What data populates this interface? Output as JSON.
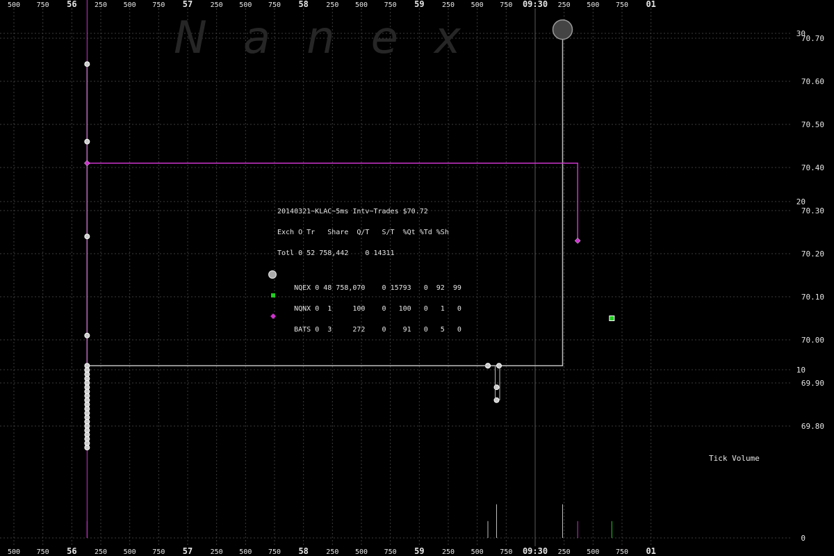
{
  "watermark": "Nanex",
  "time_axis": {
    "top_labels": [
      "500",
      "750",
      "56",
      "250",
      "500",
      "750",
      "57",
      "250",
      "500",
      "750",
      "58",
      "250",
      "500",
      "750",
      "59",
      "250",
      "500",
      "750",
      "09:30",
      "250",
      "500",
      "750",
      "01"
    ],
    "bottom_labels": [
      "500",
      "750",
      "56",
      "250",
      "500",
      "750",
      "57",
      "250",
      "500",
      "750",
      "58",
      "250",
      "500",
      "750",
      "59",
      "250",
      "500",
      "750",
      "09:30",
      "250",
      "500",
      "750",
      "01"
    ],
    "bold_labels": [
      "56",
      "57",
      "58",
      "59",
      "09:30",
      "01"
    ]
  },
  "stats_box": {
    "title": "20140321~KLAC~5ms Intv~Trades $70.72",
    "rows": [
      {
        "text": "Exch O Tr   Share  Q/T   S/T  %Qt %Td %Sh",
        "marker": ""
      },
      {
        "text": "Totl 0 52 758,442    0 14311",
        "marker": ""
      },
      {
        "text": "NQEX 0 48 758,070    0 15793   0  92  99",
        "marker": "gray-circle"
      },
      {
        "text": "NQNX 0  1     100    0   100   0   1   0",
        "marker": "green-square"
      },
      {
        "text": "BATS 0  3     272    0    91   0   5   0",
        "marker": "magenta-diamond"
      }
    ]
  },
  "volume_label": "Tick Volume",
  "colors": {
    "background": "#000000",
    "grid": "#3c3c3c",
    "nqex": "#bfbfbf",
    "nqnx": "#22cc22",
    "bats": "#cc33cc",
    "text": "#e6e6e6"
  },
  "chart_data": {
    "type": "line",
    "title": "20140321~KLAC~5ms Intv~Trades $70.72",
    "x_unit": "milliseconds after 09:29:55.500",
    "xlim": [
      0,
      6000
    ],
    "price_axis": {
      "ylim": [
        69.74,
        70.78
      ],
      "ticks": [
        "69.80",
        "69.90",
        "70.00",
        "70.10",
        "70.20",
        "70.30",
        "70.40",
        "70.50",
        "70.60",
        "70.70"
      ]
    },
    "volume_axis": {
      "ylim": [
        0,
        50
      ],
      "ticks": [
        "0",
        "10",
        "20",
        "30",
        "40",
        "50"
      ],
      "label": "Tick Volume"
    },
    "series": [
      {
        "name": "NQEX",
        "marker": "circle",
        "step_line": [
          [
            632,
            70.64
          ],
          [
            632,
            69.94
          ],
          [
            4737,
            69.94
          ],
          [
            4737,
            70.72
          ]
        ],
        "points": [
          [
            632,
            70.64
          ],
          [
            632,
            70.46
          ],
          [
            632,
            70.24
          ],
          [
            632,
            70.01
          ],
          [
            632,
            69.94
          ],
          [
            632,
            69.93
          ],
          [
            632,
            69.92
          ],
          [
            632,
            69.91
          ],
          [
            632,
            69.9
          ],
          [
            632,
            69.89
          ],
          [
            632,
            69.88
          ],
          [
            632,
            69.87
          ],
          [
            632,
            69.86
          ],
          [
            632,
            69.85
          ],
          [
            632,
            69.84
          ],
          [
            632,
            69.83
          ],
          [
            632,
            69.82
          ],
          [
            632,
            69.81
          ],
          [
            632,
            69.8
          ],
          [
            632,
            69.79
          ],
          [
            632,
            69.78
          ],
          [
            632,
            69.77
          ],
          [
            632,
            69.76
          ],
          [
            632,
            69.75
          ],
          [
            4092,
            69.94
          ],
          [
            4092,
            69.94
          ],
          [
            4167,
            69.89
          ],
          [
            4167,
            69.86
          ],
          [
            4188,
            69.94
          ]
        ],
        "big_point": [
          4737,
          70.72
        ],
        "volume": [
          [
            632,
            40
          ],
          [
            4092,
            1
          ],
          [
            4167,
            2
          ],
          [
            4737,
            2
          ]
        ]
      },
      {
        "name": "NQNX",
        "marker": "square",
        "points": [
          [
            5162,
            70.05
          ]
        ],
        "volume": [
          [
            5162,
            1
          ]
        ]
      },
      {
        "name": "BATS",
        "marker": "diamond",
        "step_line": [
          [
            632,
            70.41
          ],
          [
            4867,
            70.41
          ],
          [
            4867,
            70.23
          ]
        ],
        "points": [
          [
            632,
            70.41
          ],
          [
            4867,
            70.23
          ]
        ],
        "volume": [
          [
            632,
            1
          ],
          [
            4867,
            1
          ]
        ]
      }
    ]
  }
}
